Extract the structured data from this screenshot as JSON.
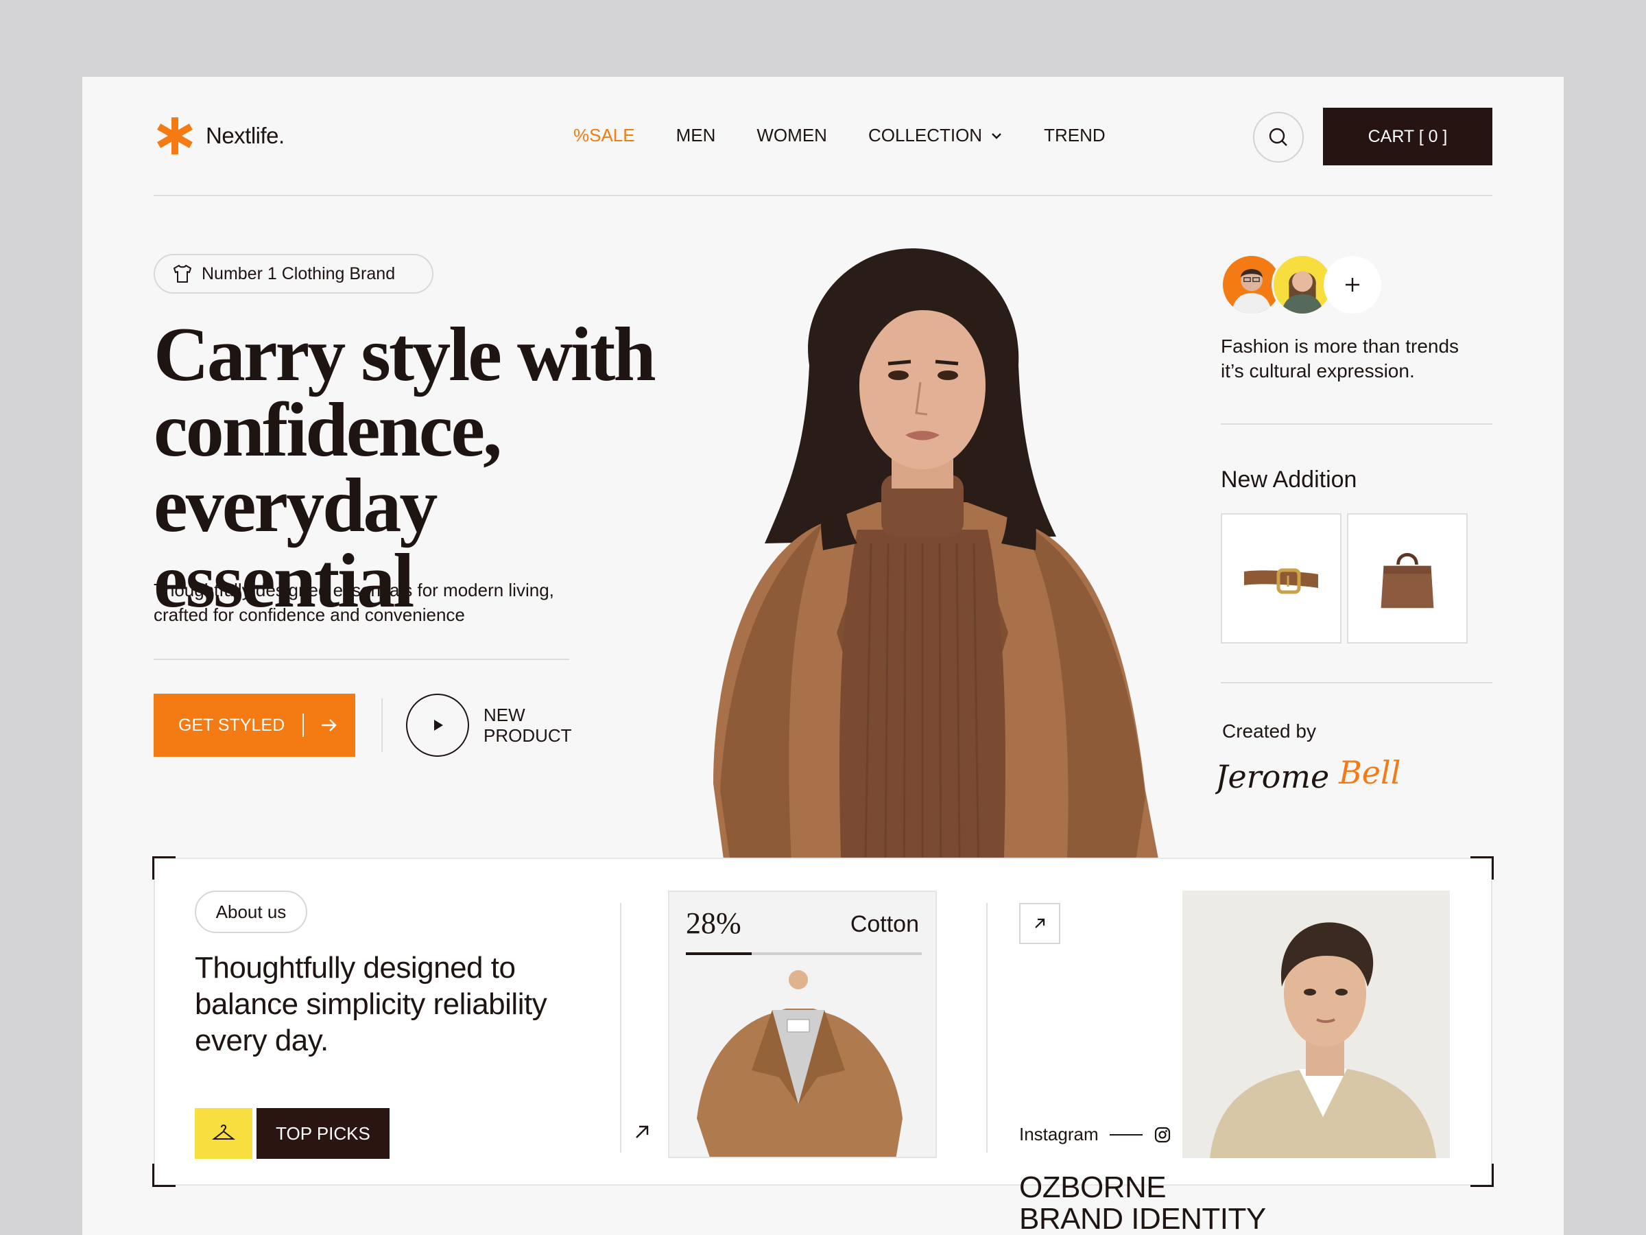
{
  "brand": {
    "name": "Nextlife."
  },
  "nav": {
    "sale": "%SALE",
    "men": "MEN",
    "women": "WOMEN",
    "collection": "COLLECTION",
    "trend": "TREND"
  },
  "header": {
    "cart_label": "CART [ 0 ]"
  },
  "hero": {
    "pill": "Number 1 Clothing  Brand",
    "title_line1": "Carry style with",
    "title_line2": "confidence, everyday",
    "title_line3": "essential",
    "subtitle_line1": "Thoughtfully designed essentials for modern living,",
    "subtitle_line2": "crafted for confidence and convenience",
    "cta_label": "GET STYLED",
    "new_product_line1": "NEW",
    "new_product_line2": "PRODUCT"
  },
  "sidebar": {
    "tagline_line1": "Fashion is more than trends",
    "tagline_line2": "it’s cultural expression.",
    "new_addition": "New Addition",
    "created_by": "Created by",
    "signature_first": "Jerome",
    "signature_last": "Bell"
  },
  "about": {
    "pill": "About us",
    "text_line1": "Thoughtfully designed to",
    "text_line2": "balance simplicity reliability",
    "text_line3": "every day.",
    "top_picks": "TOP PICKS"
  },
  "material": {
    "percent_label": "28%",
    "percent_value": 0.28,
    "fabric": "Cotton"
  },
  "social": {
    "platform": "Instagram",
    "title_line1": "OZBORNE",
    "title_line2": "BRAND IDENTITY"
  },
  "colors": {
    "accent": "#f47a14",
    "dark": "#251411",
    "yellow": "#f8de3e"
  }
}
